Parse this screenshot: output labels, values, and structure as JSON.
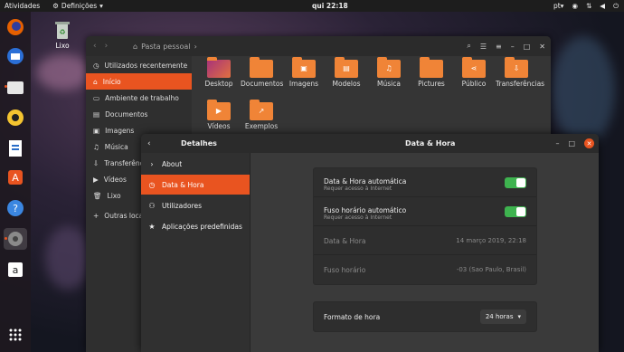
{
  "topbar": {
    "activities": "Atividades",
    "app_menu": "Definições",
    "clock": "qui 22:18",
    "lang": "pt"
  },
  "desktop": {
    "trash_label": "Lixo"
  },
  "files": {
    "path": "Pasta pessoal",
    "sidebar": [
      {
        "label": "Utilizados recentemente",
        "icon": "clock-icon"
      },
      {
        "label": "Início",
        "icon": "home-icon"
      },
      {
        "label": "Ambiente de trabalho",
        "icon": "desktop-icon"
      },
      {
        "label": "Documentos",
        "icon": "document-icon"
      },
      {
        "label": "Imagens",
        "icon": "image-icon"
      },
      {
        "label": "Música",
        "icon": "music-icon"
      },
      {
        "label": "Transferências",
        "icon": "download-icon"
      },
      {
        "label": "Vídeos",
        "icon": "video-icon"
      },
      {
        "label": "Lixo",
        "icon": "trash-icon"
      },
      {
        "label": "Outras localizações",
        "icon": "plus-icon"
      }
    ],
    "items": [
      {
        "label": "Desktop"
      },
      {
        "label": "Documentos"
      },
      {
        "label": "Imagens"
      },
      {
        "label": "Modelos"
      },
      {
        "label": "Música"
      },
      {
        "label": "Pictures"
      },
      {
        "label": "Público"
      },
      {
        "label": "Transferências"
      },
      {
        "label": "Vídeos"
      },
      {
        "label": "Exemplos"
      }
    ]
  },
  "settings": {
    "panel_title": "Detalhes",
    "title": "Data & Hora",
    "sidebar": [
      {
        "label": "About"
      },
      {
        "label": "Data & Hora"
      },
      {
        "label": "Utilizadores"
      },
      {
        "label": "Aplicações predefinidas"
      }
    ],
    "auto_datetime": {
      "label": "Data & Hora automática",
      "sub": "Requer acesso à Internet",
      "on": true
    },
    "auto_timezone": {
      "label": "Fuso horário automático",
      "sub": "Requer acesso à Internet",
      "on": true
    },
    "datetime": {
      "label": "Data & Hora",
      "value": "14 março 2019, 22:18"
    },
    "timezone": {
      "label": "Fuso horário",
      "value": "-03 (Sao Paulo, Brasil)"
    },
    "time_format": {
      "label": "Formato de hora",
      "value": "24 horas"
    }
  },
  "colors": {
    "accent": "#e95420",
    "toggle_on": "#3eb34f"
  }
}
